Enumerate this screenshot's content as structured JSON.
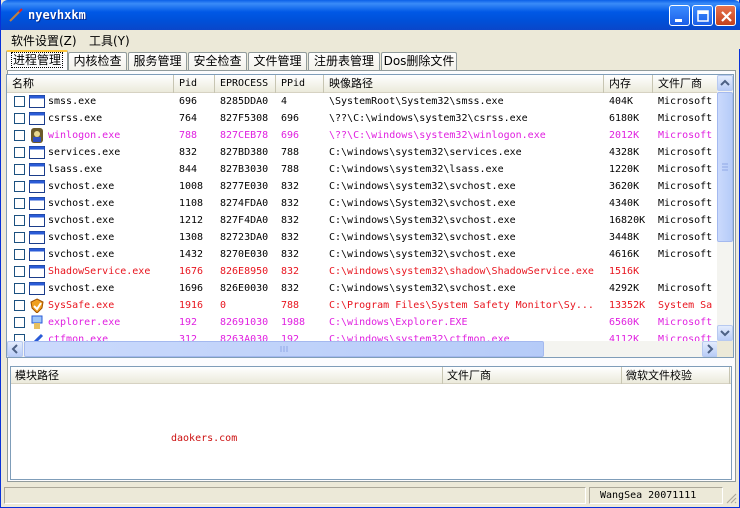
{
  "window": {
    "title": "nyevhxkm",
    "buttons": {
      "minimize": "minimize",
      "maximize": "maximize",
      "close": "close"
    }
  },
  "menu": [
    {
      "label": "软件设置(Z)"
    },
    {
      "label": "工具(Y)"
    }
  ],
  "tabs": [
    {
      "label": "进程管理",
      "active": true
    },
    {
      "label": "内核检查"
    },
    {
      "label": "服务管理"
    },
    {
      "label": "安全检查"
    },
    {
      "label": "文件管理"
    },
    {
      "label": "注册表管理"
    },
    {
      "label": "Dos删除文件"
    }
  ],
  "process_table": {
    "columns": [
      "名称",
      "Pid",
      "EPROCESS",
      "PPid",
      "映像路径",
      "内存",
      "文件厂商"
    ],
    "rows": [
      {
        "name": "smss.exe",
        "pid": "696",
        "eprocess": "8285DDA0",
        "ppid": "4",
        "path": "\\SystemRoot\\System32\\smss.exe",
        "mem": "404K",
        "vendor": "Microsoft",
        "color": "#000000",
        "icon": "window-icon"
      },
      {
        "name": "csrss.exe",
        "pid": "764",
        "eprocess": "827F5308",
        "ppid": "696",
        "path": "\\??\\C:\\windows\\system32\\csrss.exe",
        "mem": "6180K",
        "vendor": "Microsoft",
        "color": "#000000",
        "icon": "window-icon"
      },
      {
        "name": "winlogon.exe",
        "pid": "788",
        "eprocess": "827CEB78",
        "ppid": "696",
        "path": "\\??\\C:\\windows\\system32\\winlogon.exe",
        "mem": "2012K",
        "vendor": "Microsoft",
        "color": "#e020e0",
        "icon": "winlogon-icon"
      },
      {
        "name": "services.exe",
        "pid": "832",
        "eprocess": "827BD380",
        "ppid": "788",
        "path": "C:\\windows\\system32\\services.exe",
        "mem": "4328K",
        "vendor": "Microsoft",
        "color": "#000000",
        "icon": "window-icon"
      },
      {
        "name": "lsass.exe",
        "pid": "844",
        "eprocess": "827B3030",
        "ppid": "788",
        "path": "C:\\windows\\system32\\lsass.exe",
        "mem": "1220K",
        "vendor": "Microsoft",
        "color": "#000000",
        "icon": "window-icon"
      },
      {
        "name": "svchost.exe",
        "pid": "1008",
        "eprocess": "8277E030",
        "ppid": "832",
        "path": "C:\\windows\\system32\\svchost.exe",
        "mem": "3620K",
        "vendor": "Microsoft",
        "color": "#000000",
        "icon": "window-icon"
      },
      {
        "name": "svchost.exe",
        "pid": "1108",
        "eprocess": "8274FDA0",
        "ppid": "832",
        "path": "C:\\windows\\System32\\svchost.exe",
        "mem": "4340K",
        "vendor": "Microsoft",
        "color": "#000000",
        "icon": "window-icon"
      },
      {
        "name": "svchost.exe",
        "pid": "1212",
        "eprocess": "827F4DA0",
        "ppid": "832",
        "path": "C:\\windows\\System32\\svchost.exe",
        "mem": "16820K",
        "vendor": "Microsoft",
        "color": "#000000",
        "icon": "window-icon"
      },
      {
        "name": "svchost.exe",
        "pid": "1308",
        "eprocess": "82723DA0",
        "ppid": "832",
        "path": "C:\\windows\\system32\\svchost.exe",
        "mem": "3448K",
        "vendor": "Microsoft",
        "color": "#000000",
        "icon": "window-icon"
      },
      {
        "name": "svchost.exe",
        "pid": "1432",
        "eprocess": "8270E030",
        "ppid": "832",
        "path": "C:\\windows\\system32\\svchost.exe",
        "mem": "4616K",
        "vendor": "Microsoft",
        "color": "#000000",
        "icon": "window-icon"
      },
      {
        "name": "ShadowService.exe",
        "pid": "1676",
        "eprocess": "826E8950",
        "ppid": "832",
        "path": "C:\\windows\\system32\\shadow\\ShadowService.exe",
        "mem": "1516K",
        "vendor": "",
        "color": "#e8141e",
        "icon": "window-icon"
      },
      {
        "name": "svchost.exe",
        "pid": "1696",
        "eprocess": "826E0030",
        "ppid": "832",
        "path": "C:\\windows\\system32\\svchost.exe",
        "mem": "4292K",
        "vendor": "Microsoft",
        "color": "#000000",
        "icon": "window-icon"
      },
      {
        "name": "SysSafe.exe",
        "pid": "1916",
        "eprocess": "0",
        "ppid": "788",
        "path": "C:\\Program Files\\System Safety Monitor\\Sy...",
        "mem": "13352K",
        "vendor": "System Sa",
        "color": "#e8141e",
        "icon": "shield-icon"
      },
      {
        "name": "explorer.exe",
        "pid": "192",
        "eprocess": "82691030",
        "ppid": "1988",
        "path": "C:\\windows\\Explorer.EXE",
        "mem": "6560K",
        "vendor": "Microsoft",
        "color": "#e020e0",
        "icon": "explorer-icon"
      },
      {
        "name": "ctfmon.exe",
        "pid": "312",
        "eprocess": "8263A030",
        "ppid": "192",
        "path": "C:\\windows\\system32\\ctfmon.exe",
        "mem": "4112K",
        "vendor": "Microsoft",
        "color": "#e020e0",
        "icon": "pencil-icon"
      }
    ]
  },
  "module_table": {
    "columns": [
      "模块路径",
      "文件厂商",
      "微软文件校验"
    ],
    "watermark": "daokers.com"
  },
  "status": {
    "left": "",
    "right": "WangSea 20071111"
  }
}
